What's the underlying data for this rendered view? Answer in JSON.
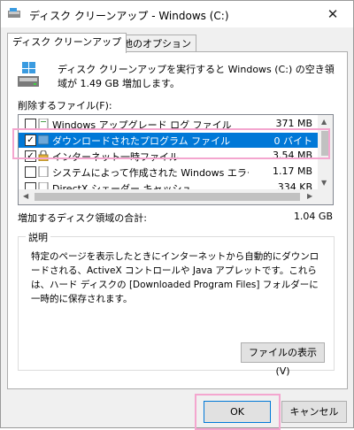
{
  "window": {
    "title": "ディスク クリーンアップ - Windows (C:)",
    "close_glyph": "✕"
  },
  "tabs": [
    {
      "label": "ディスク クリーンアップ"
    },
    {
      "label": "その他のオプション"
    }
  ],
  "intro_text": "ディスク クリーンアップを実行すると Windows (C:) の空き領域が 1.49 GB 増加します。",
  "files_label": "削除するファイル(F):",
  "files": [
    {
      "name": "Windows アップグレード ログ ファイル",
      "size": "371 MB",
      "checked": false,
      "icon": "log-file-icon"
    },
    {
      "name": "ダウンロードされたプログラム ファイル",
      "size": "0 バイト",
      "checked": true,
      "selected": true,
      "icon": "folder-icon"
    },
    {
      "name": "インターネット一時ファイル",
      "size": "3.54 MB",
      "checked": true,
      "icon": "lock-icon"
    },
    {
      "name": "システムによって作成された Windows エラー報...",
      "size": "1.17 MB",
      "checked": false,
      "icon": "file-icon"
    },
    {
      "name": "DirectX シェーダー キャッシュ",
      "size": "334 KB",
      "checked": false,
      "icon": "file-icon"
    }
  ],
  "gain_label": "増加するディスク領域の合計:",
  "gain_value": "1.04 GB",
  "description": {
    "title": "説明",
    "text": "特定のページを表示したときにインターネットから自動的にダウンロードされる、ActiveX コントロールや Java アプレットです。これらは、ハード ディスクの [Downloaded Program Files] フォルダーに一時的に保存されます。"
  },
  "buttons": {
    "view_files": "ファイルの表示(V)",
    "ok": "OK",
    "cancel": "キャンセル"
  },
  "colors": {
    "selection": "#0078d7",
    "highlight": "#f4a6cf"
  }
}
